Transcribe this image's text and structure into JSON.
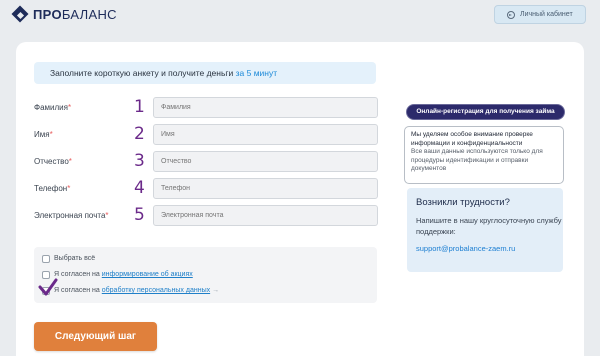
{
  "header": {
    "logo_bold": "ПРО",
    "logo_light": "БАЛАНС",
    "cabinet_label": "Личный кабинет"
  },
  "form": {
    "intro_text": "Заполните короткую анкету и получите деньги ",
    "intro_accent": "за 5 минут",
    "required_mark": "*",
    "fields": [
      {
        "label": "Фамилия",
        "number": "1",
        "placeholder": "Фамилия"
      },
      {
        "label": "Имя",
        "number": "2",
        "placeholder": "Имя"
      },
      {
        "label": "Отчество",
        "number": "3",
        "placeholder": "Отчество"
      },
      {
        "label": "Телефон",
        "number": "4",
        "placeholder": "Телефон"
      },
      {
        "label": "Электронная почта",
        "number": "5",
        "placeholder": "Электронная почта"
      }
    ],
    "select_all": "Выбрать всё",
    "agree1_prefix": "Я согласен на ",
    "agree1_link": "информирование об акциях",
    "agree2_prefix": "Я согласен на ",
    "agree2_link": "обработку персональных данных",
    "agree2_arrow": "→",
    "next_button": "Следующий шаг"
  },
  "sidebar": {
    "online_badge": "Онлайн-регистрация для получения займа",
    "privacy_strong": "Мы уделяем особое внимание проверке информации и конфиденциальности",
    "privacy_light": "Все ваши данные используются только для процедуры идентификации и отправки документов",
    "help_title": "Возникли трудности?",
    "help_text": "Напишите в нашу круглосуточную службу поддержки:",
    "help_email": "support@probalance-zaem.ru"
  },
  "colors": {
    "brand": "#1e2c5a",
    "accent_blue": "#1d8ad8",
    "button_orange": "#e0803c",
    "annotation_purple": "#6b2a8a"
  }
}
